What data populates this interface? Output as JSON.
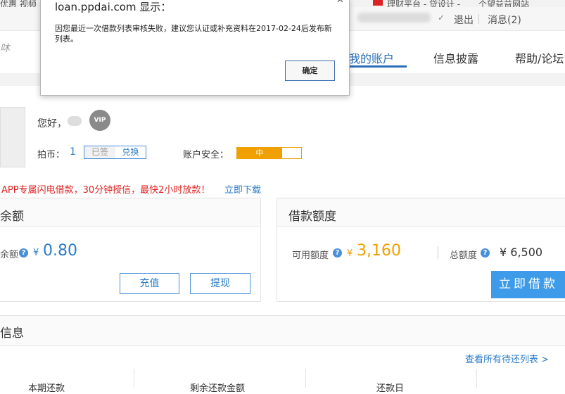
{
  "browser_strip": {
    "left_text": "优惠 视频",
    "right_text_1": "理财平台 - 贷设计 -",
    "right_text_2": "个望益益网站"
  },
  "utilbar": {
    "logout": "退出",
    "messages": "消息(2)"
  },
  "nav": {
    "my_account": "我的账户",
    "info_disclosure": "信息披露",
    "help_forum": "帮助/论坛"
  },
  "profile": {
    "greeting": "您好，",
    "vip_label": "VIP",
    "coins_label": "拍币：",
    "coins_value": "1",
    "signed_label": "已签",
    "exchange_label": "兑换",
    "security_label": "账户安全：",
    "security_level": "中",
    "security_fraction": 0.7
  },
  "promo": {
    "text": "APP专属闪电借款，30分钟授信，最快2小时放款！",
    "link": "立即下载"
  },
  "balance_panel": {
    "title": "余额",
    "balance_label": "余额",
    "currency": "¥",
    "balance_value": "0.80",
    "recharge_button": "充值",
    "withdraw_button": "提现"
  },
  "loan_panel": {
    "title": "借款额度",
    "available_label": "可用额度",
    "currency": "¥",
    "available_value": "3,160",
    "total_label": "总额度",
    "total_value": "¥ 6,500",
    "borrow_button": "立即借款"
  },
  "info_section": {
    "title": "信息",
    "view_all_link": "查看所有待还列表 >",
    "col_1": "本期还款",
    "col_2": "剩余还款金额",
    "col_3": "还款日"
  },
  "dialog": {
    "title": "loan.ppdai.com 显示：",
    "message": "因您最近一次借款列表审核失败，建议您认证或补充资料在2017-02-24后发布新列表。",
    "ok_button": "确定",
    "close_icon": "close-icon"
  },
  "colors": {
    "accent": "#2a7cc7",
    "orange": "#f0a000",
    "promo_red": "#e02020",
    "borrow_bg": "#3d9be9"
  }
}
